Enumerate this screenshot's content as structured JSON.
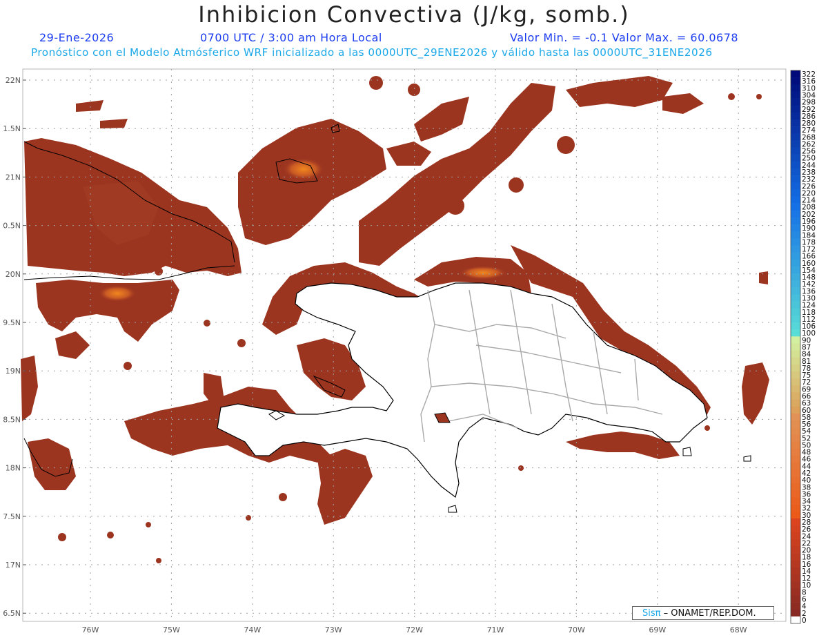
{
  "header": {
    "title": "Inhibicion Convectiva (J/kg, somb.)",
    "date": "29-Ene-2026",
    "time": "0700 UTC / 3:00 am Hora Local",
    "minmax": "Valor Min. = -0.1  Valor Max. = 60.0678",
    "subtitle": "Pronóstico con el Modelo Atmósferico WRF inicializado a las 0000UTC_29ENE2026 y válido hasta las  0000UTC_31ENE2026"
  },
  "axes": {
    "lat_labels": [
      "22N",
      "1.5N",
      "21N",
      "0.5N",
      "20N",
      "9.5N",
      "19N",
      "8.5N",
      "18N",
      "7.5N",
      "17N",
      "6.5N"
    ],
    "lon_labels": [
      "76W",
      "75W",
      "74W",
      "73W",
      "72W",
      "71W",
      "70W",
      "69W",
      "68W"
    ]
  },
  "legend": {
    "labels": [
      "322",
      "316",
      "310",
      "304",
      "298",
      "292",
      "286",
      "280",
      "274",
      "268",
      "262",
      "256",
      "250",
      "244",
      "238",
      "232",
      "226",
      "220",
      "214",
      "208",
      "202",
      "196",
      "190",
      "184",
      "178",
      "172",
      "166",
      "160",
      "154",
      "148",
      "142",
      "136",
      "130",
      "124",
      "118",
      "112",
      "106",
      "100",
      "90",
      "87",
      "84",
      "81",
      "78",
      "75",
      "72",
      "69",
      "66",
      "63",
      "60",
      "58",
      "56",
      "54",
      "52",
      "50",
      "48",
      "46",
      "44",
      "42",
      "40",
      "38",
      "36",
      "34",
      "32",
      "30",
      "28",
      "26",
      "24",
      "22",
      "20",
      "18",
      "16",
      "14",
      "12",
      "10",
      "8",
      "6",
      "4",
      "2",
      "0"
    ]
  },
  "credit": {
    "logo": "Sisπ",
    "text": "– ONAMET/REP.DOM."
  },
  "colors": {
    "field": "#9c3520",
    "field_hot": "#e8761c",
    "coast": "#000000",
    "borders": "#a8a8a8"
  }
}
